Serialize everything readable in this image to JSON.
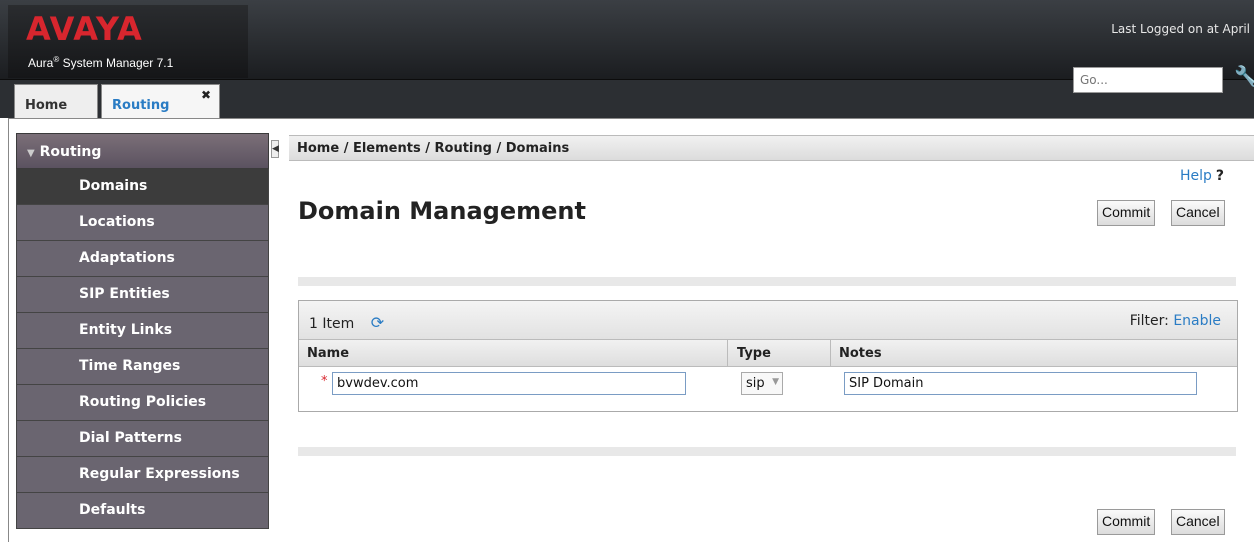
{
  "header": {
    "logo": "AVAYA",
    "product_prefix": "Aura",
    "product_reg": "®",
    "product_name": " System Manager 7.1",
    "last_logged": "Last Logged on at April",
    "search_placeholder": "Go..."
  },
  "tabs": [
    {
      "label": "Home"
    },
    {
      "label": "Routing",
      "active": true
    }
  ],
  "sidebar": {
    "header": "Routing",
    "items": [
      {
        "label": "Domains",
        "active": true
      },
      {
        "label": "Locations"
      },
      {
        "label": "Adaptations"
      },
      {
        "label": "SIP Entities"
      },
      {
        "label": "Entity Links"
      },
      {
        "label": "Time Ranges"
      },
      {
        "label": "Routing Policies"
      },
      {
        "label": "Dial Patterns"
      },
      {
        "label": "Regular Expressions"
      },
      {
        "label": "Defaults"
      }
    ]
  },
  "breadcrumb": "Home / Elements / Routing / Domains",
  "help": {
    "label": "Help",
    "mark": "?"
  },
  "page_title": "Domain Management",
  "buttons": {
    "commit": "Commit",
    "cancel": "Cancel"
  },
  "table": {
    "count_label": "1 Item",
    "filter_label": "Filter:",
    "filter_action": "Enable",
    "columns": [
      "Name",
      "Type",
      "Notes"
    ],
    "rows": [
      {
        "name": "bvwdev.com",
        "type": "sip",
        "notes": "SIP Domain"
      }
    ]
  },
  "colors": {
    "brand_red": "#d8262e",
    "link_blue": "#2a7cc4",
    "nav_bg": "#6a6570",
    "nav_active": "#3c3c3c"
  }
}
